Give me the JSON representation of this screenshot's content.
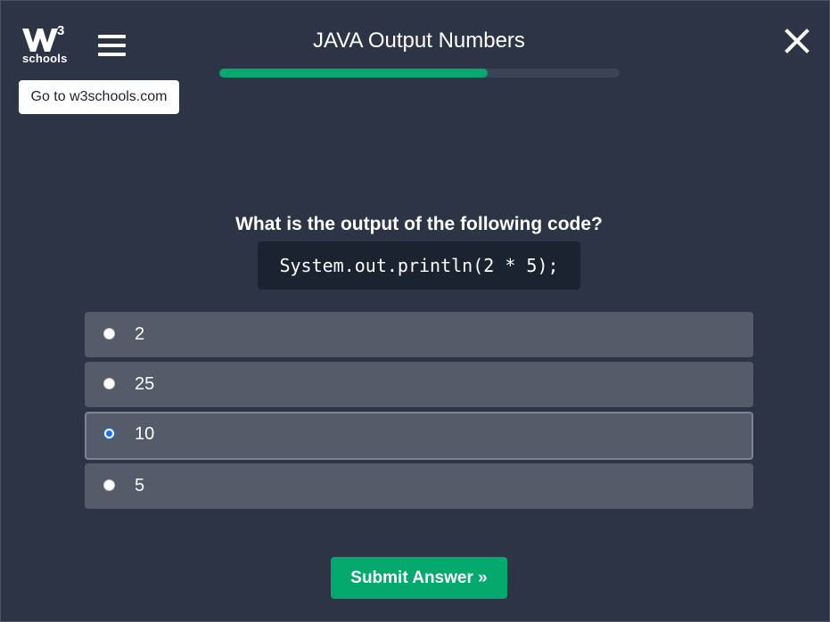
{
  "header": {
    "logo": {
      "superscript": "3",
      "text": "schools",
      "icon": "w3schools-logo-icon"
    },
    "menu_icon": "hamburger-menu-icon",
    "goto_label": "Go to w3schools.com",
    "title": "JAVA Output Numbers",
    "progress_fraction": 0.67,
    "close_icon": "close-icon"
  },
  "quiz": {
    "question": "What is the output of the following code?",
    "code": "System.out.println(2 * 5);",
    "options": [
      {
        "label": "2",
        "selected": false
      },
      {
        "label": "25",
        "selected": false
      },
      {
        "label": "10",
        "selected": true
      },
      {
        "label": "5",
        "selected": false
      }
    ],
    "submit_label": "Submit Answer »"
  },
  "colors": {
    "background": "#2d3446",
    "accent": "#04aa6d",
    "option_bg": "#555b68",
    "code_bg": "#1b2230",
    "radio_selected": "#1a73e8"
  }
}
